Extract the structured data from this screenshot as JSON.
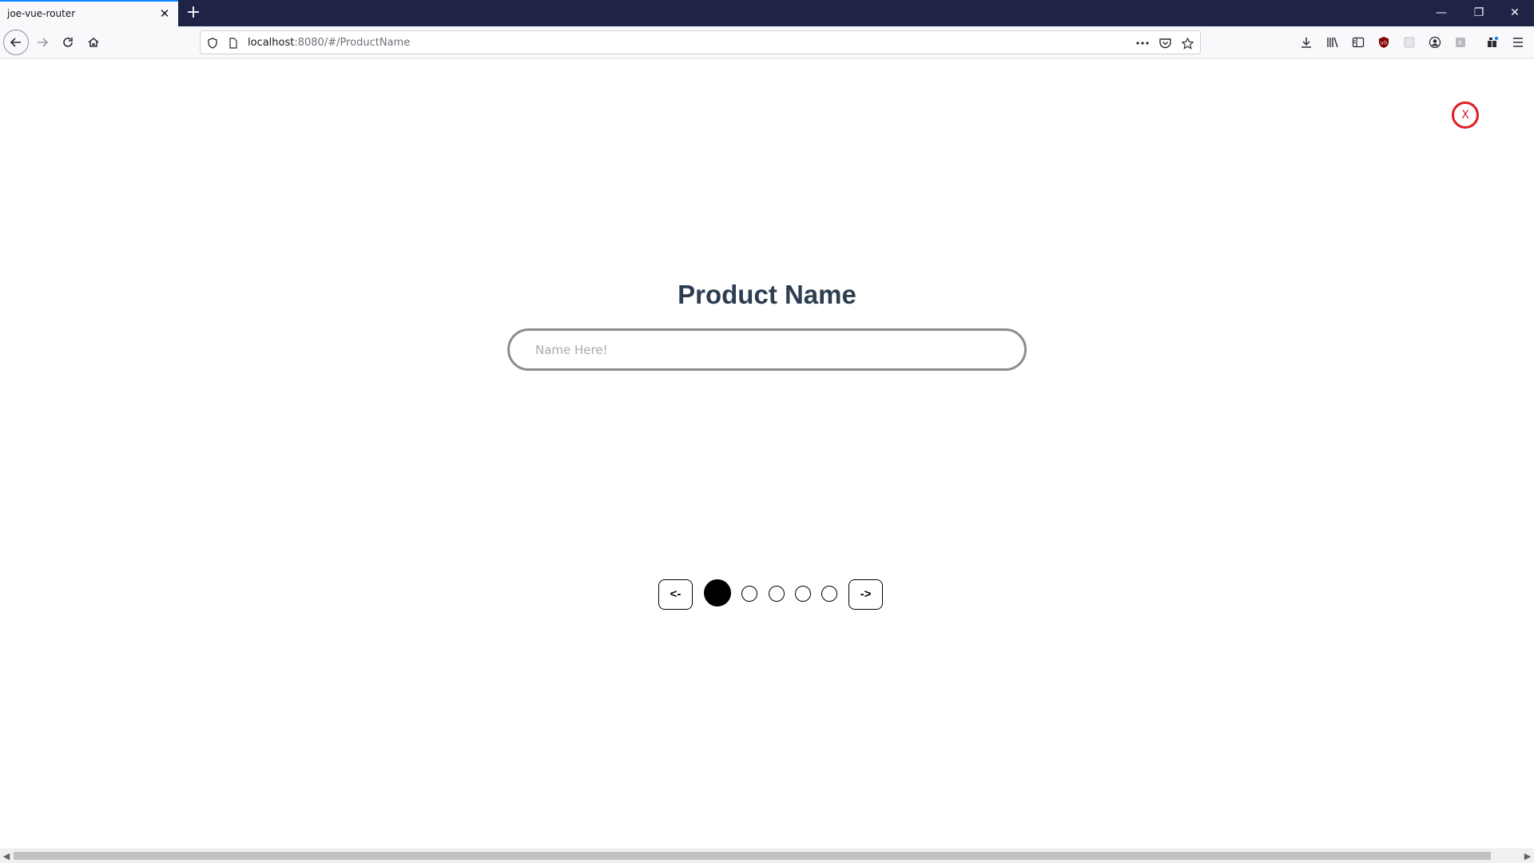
{
  "browser": {
    "tab_title": "joe-vue-router",
    "tab_close": "✕",
    "new_tab": "+",
    "url_host": "localhost",
    "url_rest": ":8080/#/ProductName",
    "window_controls": {
      "minimize": "—",
      "restore": "❐",
      "close": "✕"
    }
  },
  "page": {
    "close_label": "X",
    "title": "Product Name",
    "input_placeholder": "Name Here!",
    "input_value": "",
    "prev_label": "<-",
    "next_label": "->",
    "steps_total": 5,
    "step_current": 1
  },
  "colors": {
    "tabstrip": "#1f2447",
    "title": "#2c3e50",
    "close_accent": "#e01b24",
    "tab_active_line": "#0a84ff"
  },
  "icons": [
    "back-arrow-icon",
    "forward-arrow-icon",
    "reload-icon",
    "home-icon",
    "shield-icon",
    "page-icon",
    "more-icon",
    "pocket-icon",
    "star-icon",
    "download-icon",
    "library-icon",
    "sidebar-icon",
    "ublock-icon",
    "extension-icon",
    "account-icon",
    "container-icon",
    "extensions-icon",
    "menu-icon"
  ]
}
